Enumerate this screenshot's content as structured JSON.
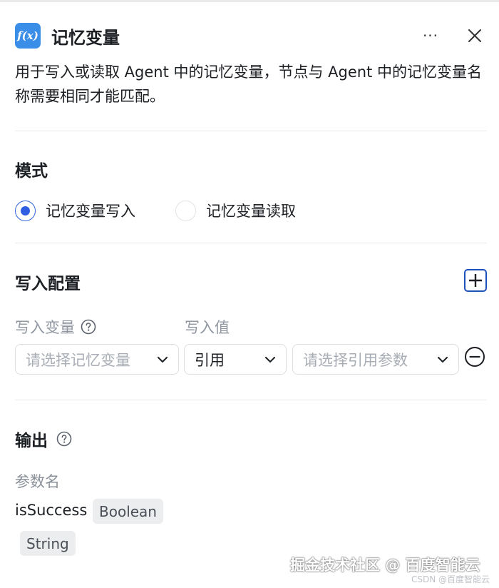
{
  "header": {
    "icon_text": "f(x)",
    "title": "记忆变量",
    "more_label": "···"
  },
  "description": "用于写入或读取 Agent 中的记忆变量，节点与 Agent 中的记忆变量名称需要相同才能匹配。",
  "mode": {
    "title": "模式",
    "options": [
      {
        "label": "记忆变量写入",
        "selected": true
      },
      {
        "label": "记忆变量读取",
        "selected": false
      }
    ]
  },
  "write_config": {
    "title": "写入配置",
    "var_label": "写入变量",
    "value_label": "写入值",
    "var_placeholder": "请选择记忆变量",
    "value_type": "引用",
    "ref_placeholder": "请选择引用参数"
  },
  "output": {
    "title": "输出",
    "params_label": "参数名",
    "param_name": "isSuccess",
    "param_type": "Boolean",
    "extra_type": "String"
  },
  "watermark": {
    "main": "掘金技术社区 @ 百度智能云",
    "sub": "CSDN @百度智能云"
  },
  "colors": {
    "accent": "#2f5ee0",
    "icon_bg": "#3b8ee8",
    "add_btn": "#1f4fb8"
  }
}
